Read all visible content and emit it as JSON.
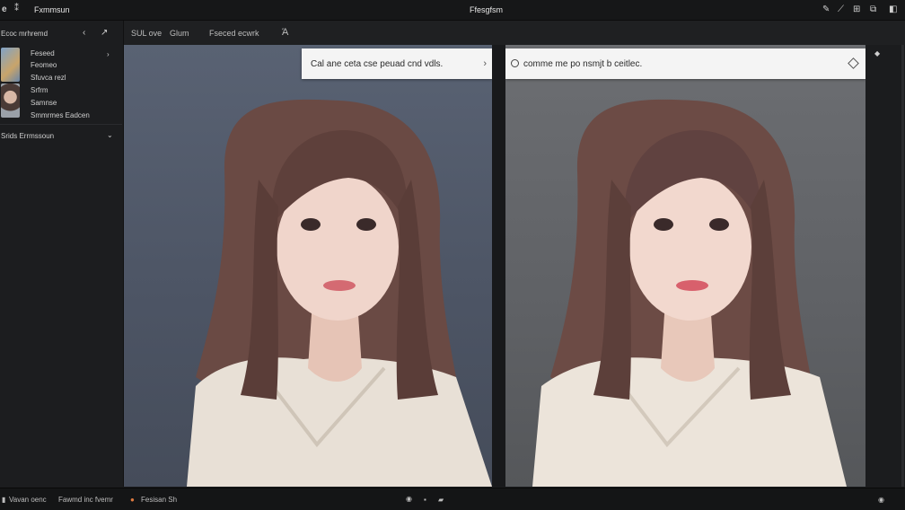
{
  "titlebar": {
    "app_name": "Fxmmsun",
    "center_title": "Ffesgfsm"
  },
  "toolbar": {
    "item1": "SUL ove",
    "item2": "Glum",
    "item3": "Fseced ecwrk"
  },
  "sidebar": {
    "header": "Ecoc mrhremd",
    "items": [
      {
        "label": "Feseed"
      },
      {
        "label": "Feomeo"
      },
      {
        "label": "Sfuvca rezl"
      },
      {
        "label": "Srfrm"
      },
      {
        "label": "Samnse"
      },
      {
        "label": "Smmrmes Eadcen"
      }
    ],
    "section": "Srids Errmssoun"
  },
  "prompts": {
    "left": "Cal ane ceta cse peuad cnd vdls.",
    "right": "comme me po nsmjt b ceitlec."
  },
  "statusbar": {
    "item1": "Vavan oenc",
    "item2": "Fawmd inc fvemr",
    "item3": "Fesisan Sh"
  },
  "colors": {
    "prompt_bg": "#f4f4f4",
    "chrome_bg": "#1b1c1e",
    "left_bg": "#4d5565",
    "right_bg": "#5f6165"
  }
}
